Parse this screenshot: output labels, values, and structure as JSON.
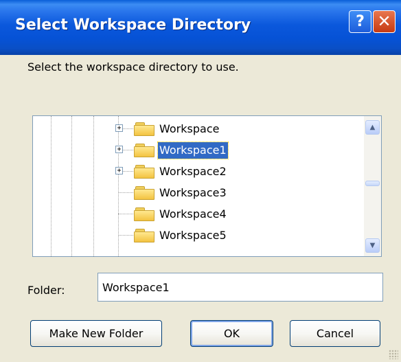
{
  "window": {
    "title": "Select Workspace Directory"
  },
  "title_buttons": {
    "help": "?",
    "close": "✕"
  },
  "instruction": "Select the workspace directory to use.",
  "tree": {
    "items": [
      {
        "label": "Workspace",
        "expandable": true,
        "selected": false
      },
      {
        "label": "Workspace1",
        "expandable": true,
        "selected": true
      },
      {
        "label": "Workspace2",
        "expandable": true,
        "selected": false
      },
      {
        "label": "Workspace3",
        "expandable": false,
        "selected": false
      },
      {
        "label": "Workspace4",
        "expandable": false,
        "selected": false
      },
      {
        "label": "Workspace5",
        "expandable": false,
        "selected": false
      }
    ],
    "expander_glyph": "+",
    "scroll_up_glyph": "▲",
    "scroll_down_glyph": "▼",
    "folder_icon": "folder-icon",
    "selected_color": "#316AC5"
  },
  "folder_field": {
    "label": "Folder:",
    "value": "Workspace1"
  },
  "buttons": {
    "make_new_folder": "Make New Folder",
    "ok": "OK",
    "cancel": "Cancel"
  },
  "colors": {
    "title_bar": "#0A56D6",
    "dialog_bg": "#ECE9D8",
    "close_button": "#D2461E"
  }
}
